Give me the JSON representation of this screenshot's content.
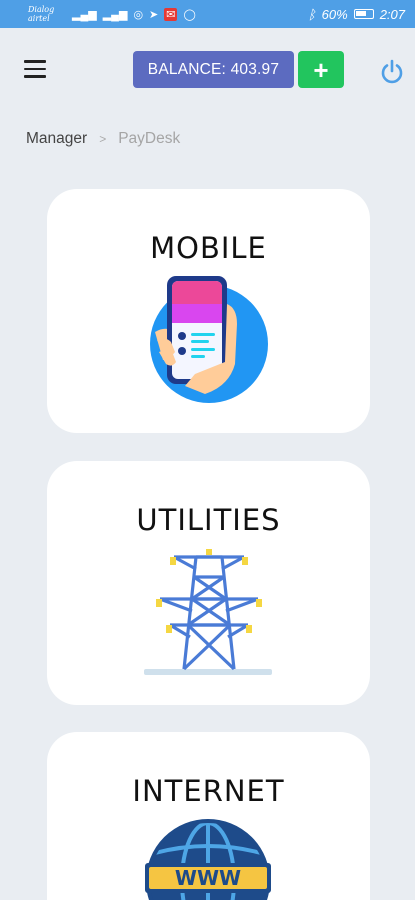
{
  "status_bar": {
    "carrier": "Dialog\nairtel",
    "battery": "60%",
    "time": "2:07",
    "icons": [
      "signal-icon",
      "signal-icon",
      "wifi-icon",
      "telegram-icon",
      "mail-icon",
      "whatsapp-icon",
      "bluetooth-icon",
      "battery-icon"
    ]
  },
  "header": {
    "balance_label": "BALANCE: 403.97",
    "add_label": "+",
    "colors": {
      "balance": "#5c6bc0",
      "add": "#22c55e",
      "power": "#4f9fe6"
    }
  },
  "breadcrumb": {
    "parent": "Manager",
    "separator": ">",
    "current": "PayDesk"
  },
  "cards": [
    {
      "title": "MOBILE",
      "icon": "mobile-phone-icon"
    },
    {
      "title": "UTILITIES",
      "icon": "power-tower-icon"
    },
    {
      "title": "INTERNET",
      "icon": "globe-www-icon"
    }
  ]
}
